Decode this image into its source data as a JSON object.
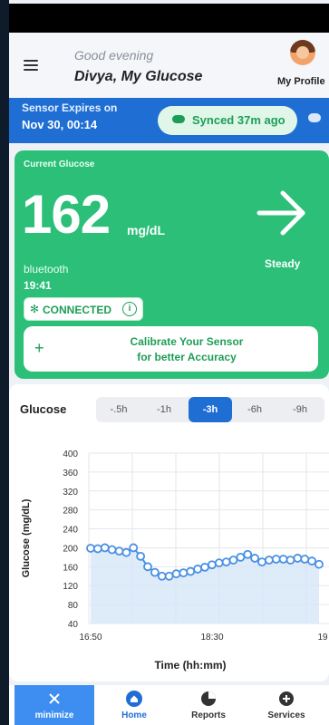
{
  "header": {
    "greeting": "Good evening",
    "name": "Divya, My Glucose",
    "profile_label": "My Profile"
  },
  "sensor": {
    "label": "Sensor Expires on",
    "date": "Nov 30, 00:14",
    "synced": "Synced 37m ago"
  },
  "glucose": {
    "label": "Current Glucose",
    "value": "162",
    "unit": "mg/dL",
    "trend": "Steady",
    "source": "bluetooth",
    "time": "19:41",
    "status": "CONNECTED",
    "calibrate_line1": "Calibrate Your Sensor",
    "calibrate_line2": "for better Accuracy"
  },
  "chart_card": {
    "title": "Glucose",
    "ranges": [
      ".5h",
      "-1h",
      "-3h",
      "-6h",
      "-9h"
    ],
    "ranges_display": [
      "-.5h",
      "-1h",
      "-3h",
      "-6h",
      "-9h"
    ],
    "active_range": "-3h"
  },
  "chart_data": {
    "type": "line",
    "ylabel": "Glucose (mg/dL)",
    "xlabel": "Time (hh:mm)",
    "ylim": [
      40,
      400
    ],
    "yticks": [
      400,
      360,
      320,
      280,
      240,
      200,
      160,
      120,
      80,
      40
    ],
    "xticks": [
      "16:50",
      "18:30",
      "19"
    ],
    "series": [
      {
        "values": [
          199,
          198,
          200,
          196,
          193,
          190,
          200,
          182,
          160,
          148,
          140,
          140,
          145,
          147,
          150,
          155,
          159,
          164,
          168,
          170,
          174,
          180,
          186,
          178,
          170,
          174,
          176,
          176,
          174,
          178,
          176,
          172,
          165
        ]
      }
    ],
    "line_color": "#4a90e2",
    "fill_color": "#d6e6f8",
    "grid": true
  },
  "nav": {
    "items": [
      {
        "label": "minimize",
        "icon": "close-icon"
      },
      {
        "label": "Home",
        "icon": "home-icon"
      },
      {
        "label": "Reports",
        "icon": "pie-chart-icon"
      },
      {
        "label": "Services",
        "icon": "plus-circle-icon"
      }
    ]
  }
}
